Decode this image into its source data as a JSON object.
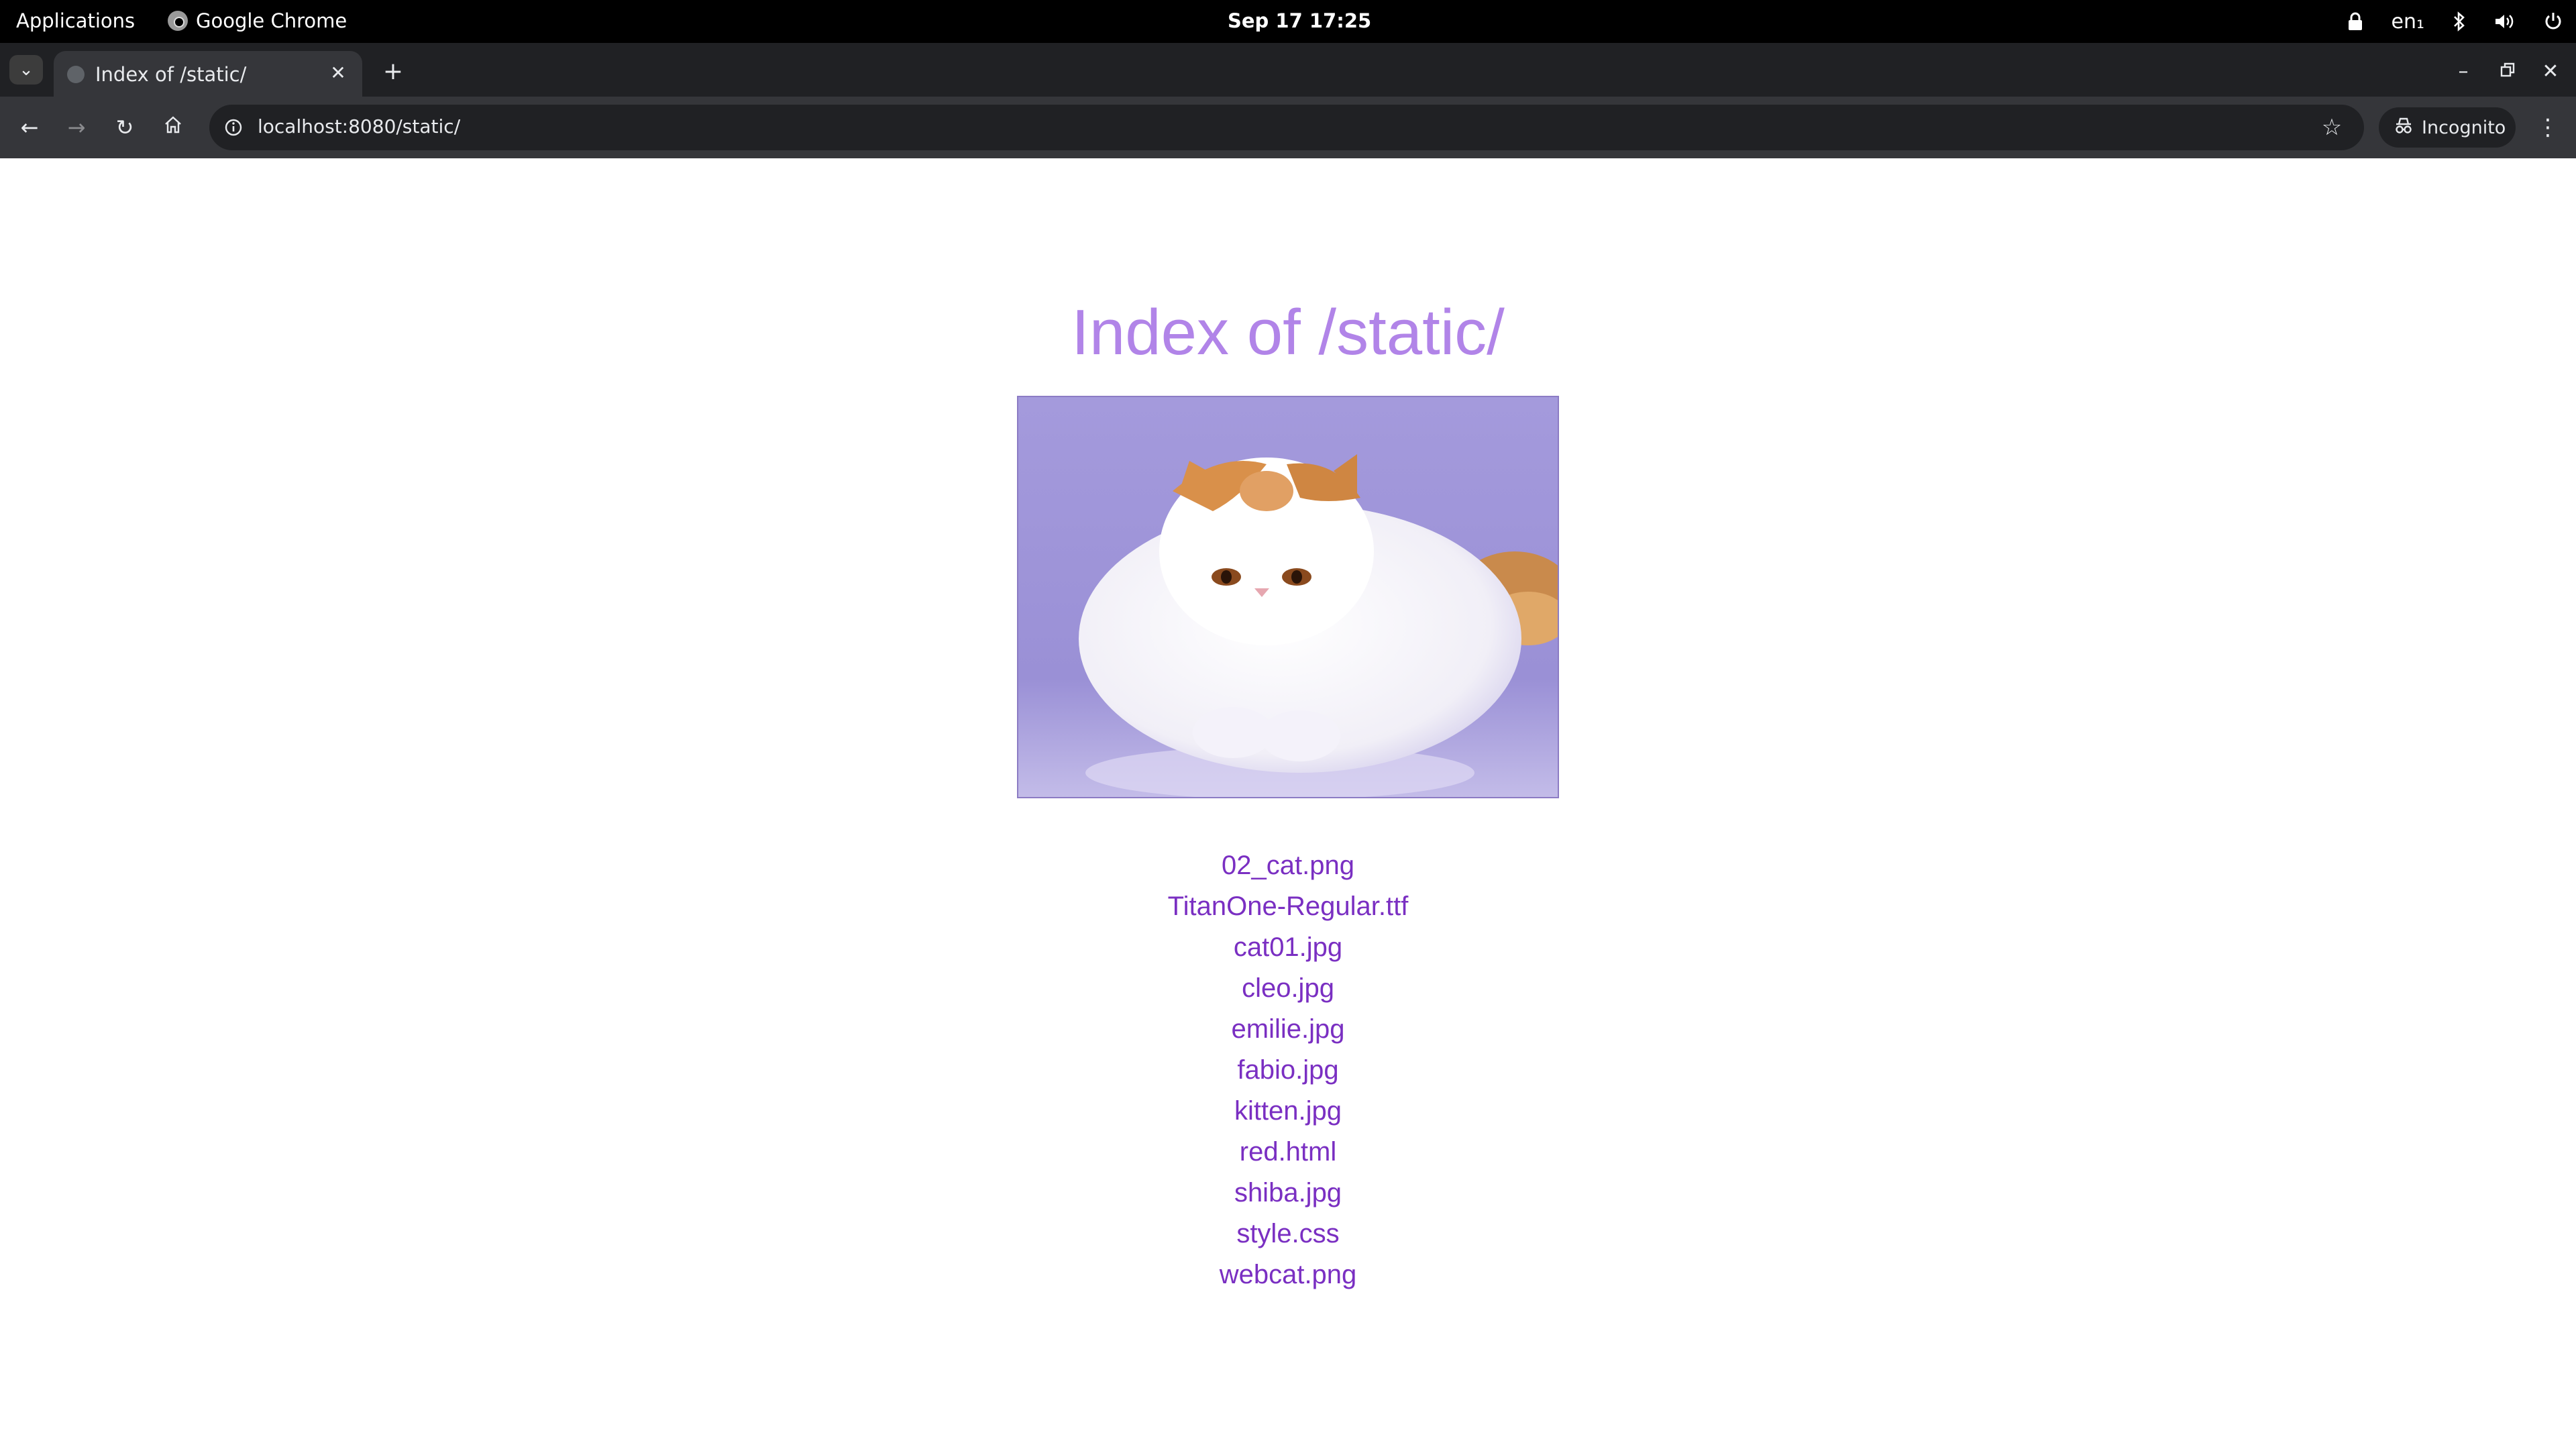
{
  "system_bar": {
    "applications_label": "Applications",
    "active_app": "Google Chrome",
    "clock": "Sep 17  17:25",
    "keyboard_layout": "en₁",
    "icons": [
      "lock-icon",
      "bluetooth-icon",
      "volume-icon",
      "power-icon"
    ]
  },
  "browser": {
    "tab": {
      "title": "Index of /static/"
    },
    "address_bar": {
      "url": "localhost:8080/static/"
    },
    "incognito_label": "Incognito"
  },
  "page": {
    "heading": "Index of /static/",
    "colors": {
      "heading": "#b184e8",
      "link": "#7a2fc2",
      "photo_background": "#9d92d8"
    },
    "files": [
      "02_cat.png",
      "TitanOne-Regular.ttf",
      "cat01.jpg",
      "cleo.jpg",
      "emilie.jpg",
      "fabio.jpg",
      "kitten.jpg",
      "red.html",
      "shiba.jpg",
      "style.css",
      "webcat.png"
    ]
  }
}
